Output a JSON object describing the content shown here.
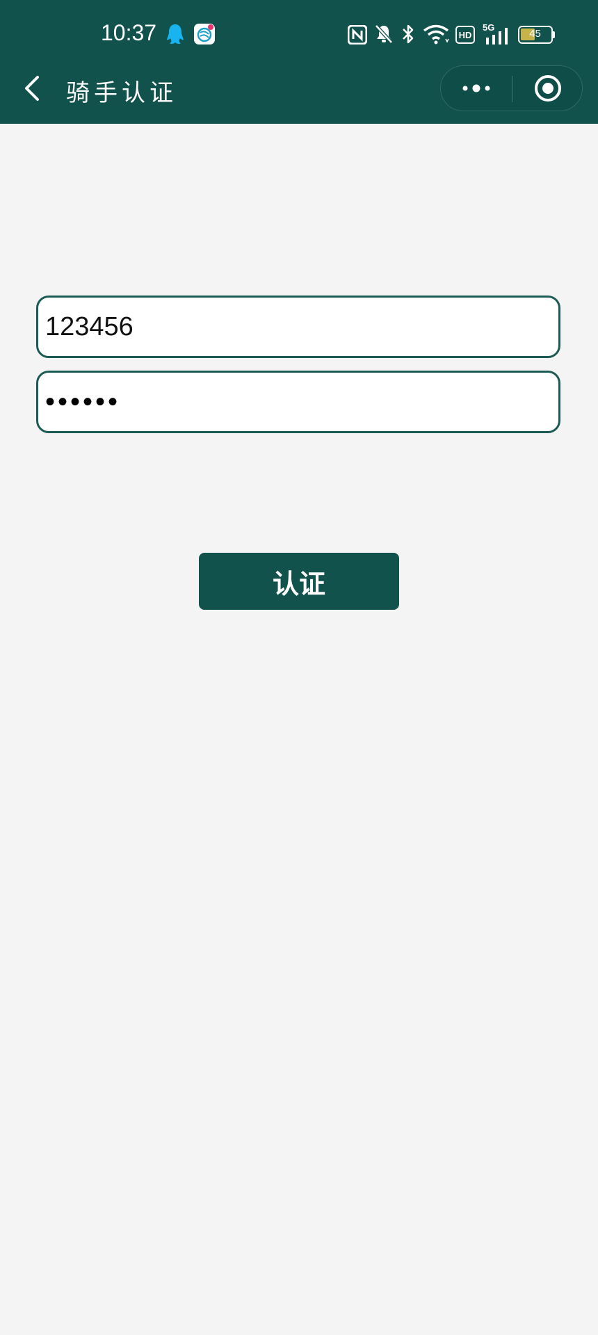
{
  "status_bar": {
    "time": "10:37",
    "battery": "45",
    "network": "5G",
    "hd": "HD",
    "icons": [
      "qq-icon",
      "mobile-carrier-icon",
      "nfc-icon",
      "mute-icon",
      "bluetooth-icon",
      "wifi-icon",
      "hd-icon",
      "signal-icon",
      "battery-icon"
    ]
  },
  "nav": {
    "title": "骑手认证",
    "back_icon": "chevron-left-icon",
    "more_icon": "more-dots-icon",
    "close_icon": "target-close-icon"
  },
  "form": {
    "username_value": "123456",
    "password_value": "123456",
    "submit_label": "认证"
  },
  "colors": {
    "primary": "#11524d",
    "background": "#f4f4f4",
    "field_border": "#1c5a55"
  }
}
